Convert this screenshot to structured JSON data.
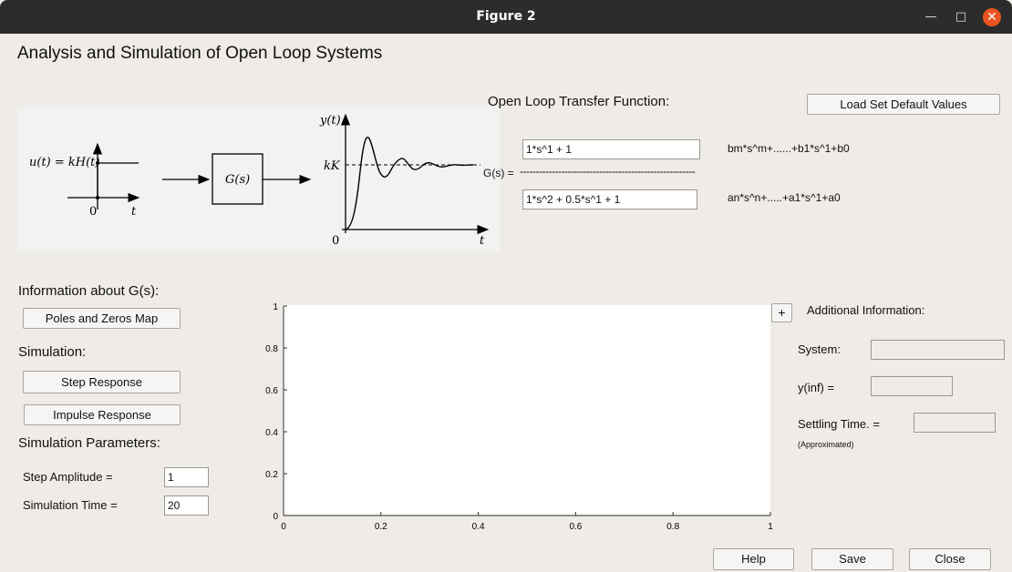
{
  "window": {
    "title": "Figure 2"
  },
  "heading": "Analysis and Simulation of Open Loop Systems",
  "diagram": {
    "input_label": "u(t) = kH(t)",
    "block_label": "G(s)",
    "output_y_label": "y(t)",
    "steady_label": "kK",
    "zero_left": "0",
    "t_left": "t",
    "zero_right": "0",
    "t_right": "t"
  },
  "transfer_function": {
    "title": "Open Loop Transfer Function:",
    "load_defaults_label": "Load Set Default Values",
    "g_label": "G(s) =",
    "numerator": "1*s^1 + 1",
    "denominator": "1*s^2 + 0.5*s^1 + 1",
    "numerator_hint": "bm*s^m+......+b1*s^1+b0",
    "denominator_hint": "an*s^n+.....+a1*s^1+a0",
    "divider": "-------------------------------------------------------"
  },
  "info": {
    "title": "Information about G(s):",
    "poles_zeros_label": "Poles and Zeros Map"
  },
  "simulation": {
    "title": "Simulation:",
    "step_label": "Step Response",
    "impulse_label": "Impulse Response"
  },
  "params": {
    "title": "Simulation Parameters:",
    "step_amp_label": "Step Amplitude =",
    "step_amp_value": "1",
    "sim_time_label": "Simulation Time =",
    "sim_time_value": "20"
  },
  "additional": {
    "plus_label": "+",
    "title": "Additional Information:",
    "system_label": "System:",
    "system_value": "",
    "yinf_label": "y(inf) =",
    "yinf_value": "",
    "settling_label": "Settling Time. =",
    "settling_value": "",
    "approx_label": "(Approximated)"
  },
  "footer": {
    "help_label": "Help",
    "save_label": "Save",
    "close_label": "Close"
  },
  "chart_data": {
    "type": "line",
    "series": [],
    "xlim": [
      0,
      1
    ],
    "ylim": [
      0,
      1
    ],
    "xticks": [
      "0",
      "0.2",
      "0.4",
      "0.6",
      "0.8",
      "1"
    ],
    "yticks": [
      "0",
      "0.2",
      "0.4",
      "0.6",
      "0.8",
      "1"
    ],
    "grid": false
  }
}
